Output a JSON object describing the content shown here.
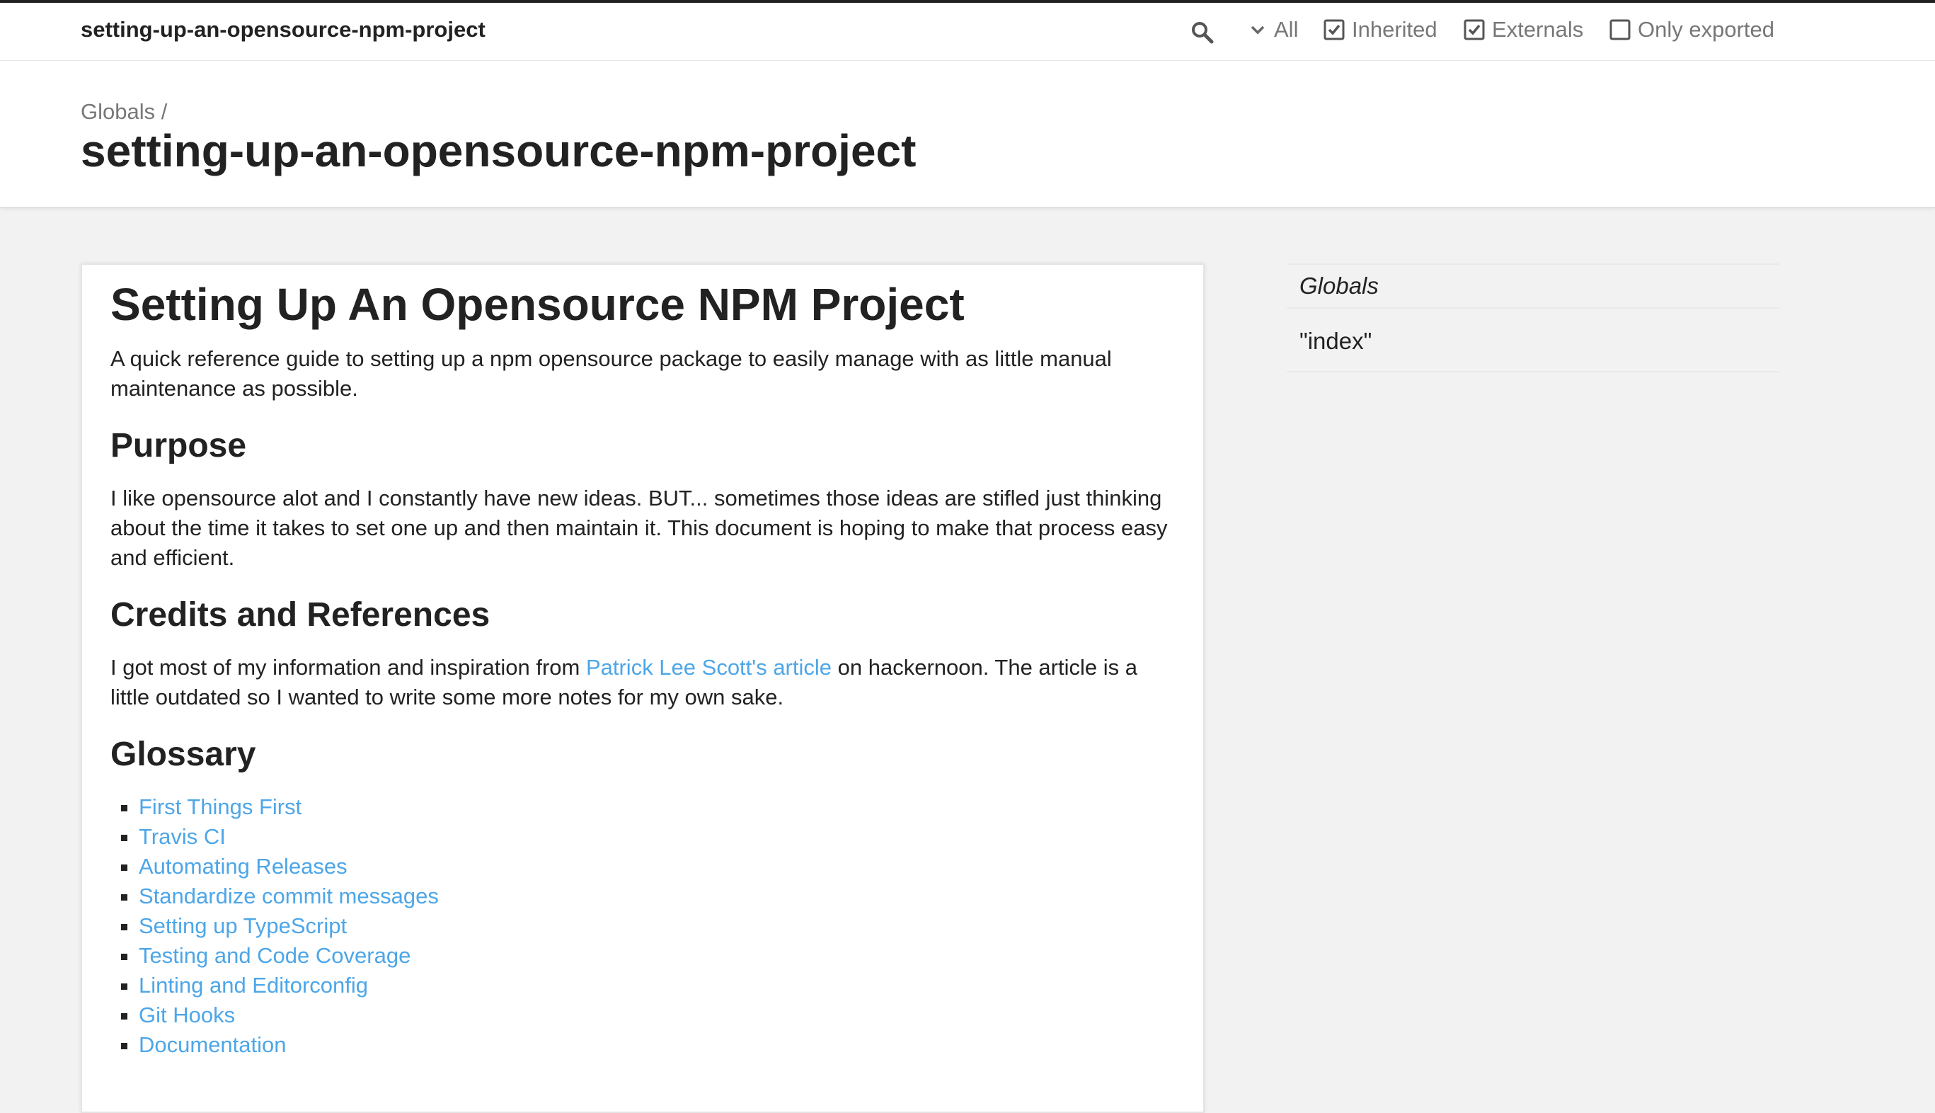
{
  "toolbar": {
    "project_title": "setting-up-an-opensource-npm-project",
    "search_icon": "search-icon",
    "filters": {
      "all_label": "All",
      "inherited_label": "Inherited",
      "inherited_checked": true,
      "externals_label": "Externals",
      "externals_checked": true,
      "only_exported_label": "Only exported",
      "only_exported_checked": false
    }
  },
  "header": {
    "breadcrumb_link": "Globals",
    "breadcrumb_separator": " /",
    "title": "setting-up-an-opensource-npm-project"
  },
  "content": {
    "title": "Setting Up An Opensource NPM Project",
    "intro": "A quick reference guide to setting up a npm opensource package to easily manage with as little manual maintenance as possible.",
    "purpose_heading": "Purpose",
    "purpose_text": "I like opensource alot and I constantly have new ideas. BUT... sometimes those ideas are stifled just thinking about the time it takes to set one up and then maintain it. This document is hoping to make that process easy and efficient.",
    "credits_heading": "Credits and References",
    "credits_before": "I got most of my information and inspiration from ",
    "credits_link": "Patrick Lee Scott's article",
    "credits_after": " on hackernoon. The article is a little outdated so I wanted to write some more notes for my own sake.",
    "glossary_heading": "Glossary",
    "glossary": [
      "First Things First",
      "Travis CI",
      "Automating Releases",
      "Standardize commit messages",
      "Setting up TypeScript",
      "Testing and Code Coverage",
      "Linting and Editorconfig",
      "Git Hooks",
      "Documentation"
    ]
  },
  "sidebar": {
    "items": [
      {
        "label": "Globals"
      },
      {
        "label": "\"index\""
      }
    ]
  },
  "colors": {
    "link": "#4da6e8",
    "text": "#222222",
    "muted": "#777777",
    "background": "#f2f2f2"
  }
}
